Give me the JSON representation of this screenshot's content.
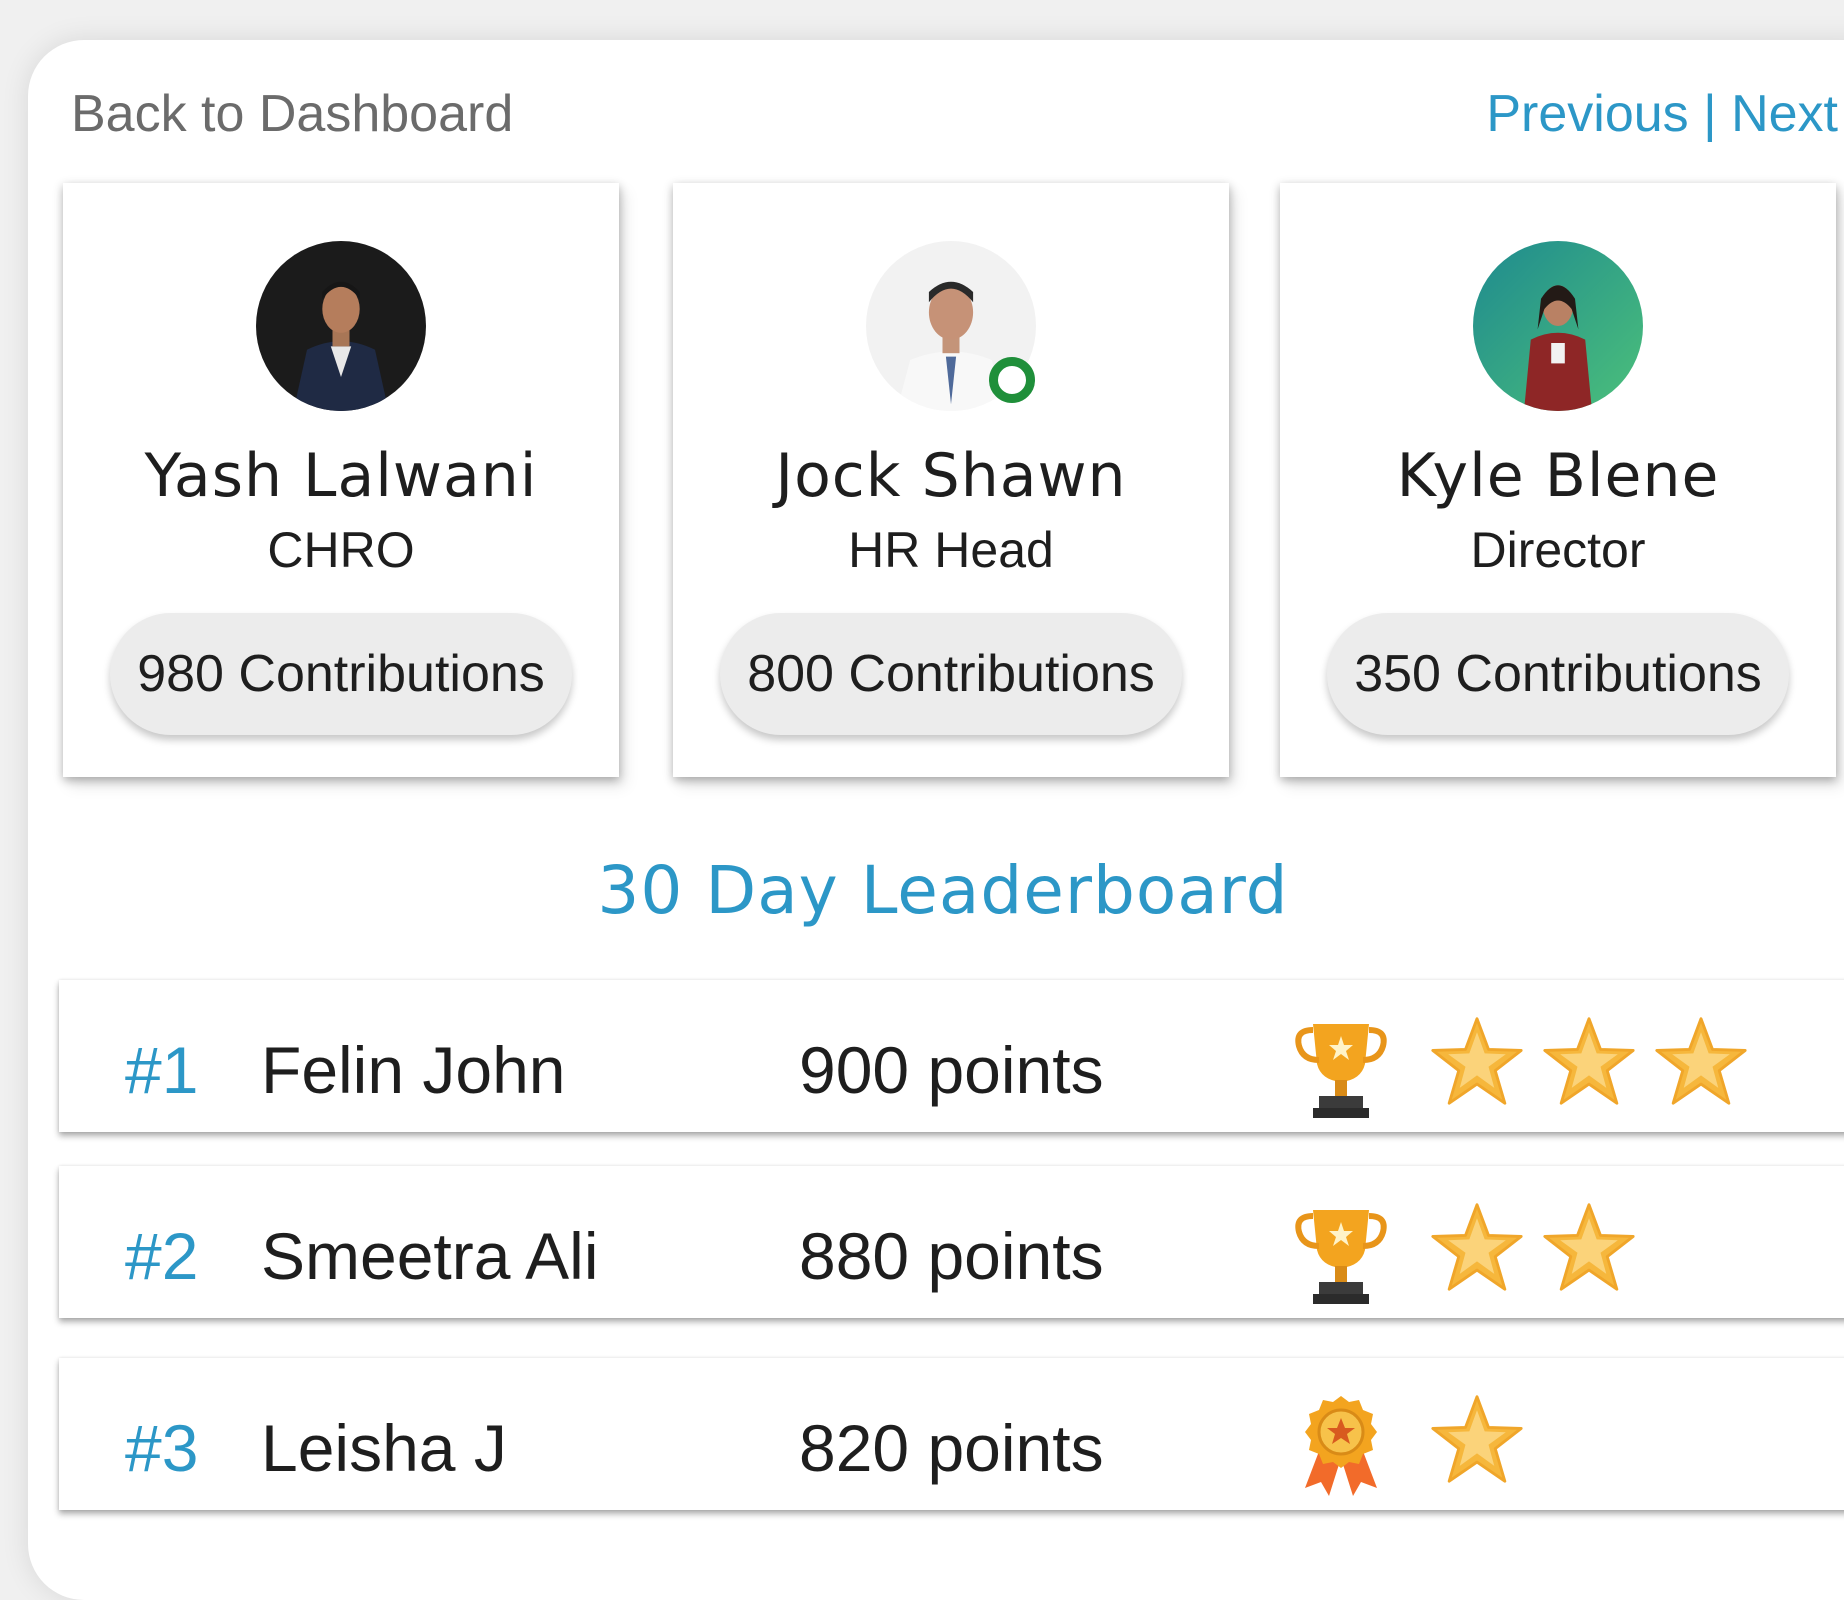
{
  "nav": {
    "back_label": "Back to Dashboard",
    "previous_label": "Previous",
    "separator": "|",
    "next_label": "Next"
  },
  "featured": [
    {
      "name": "Yash Lalwani",
      "role": "CHRO",
      "contributions": "980 Contributions",
      "online": false
    },
    {
      "name": "Jock Shawn",
      "role": "HR Head",
      "contributions": "800 Contributions",
      "online": true
    },
    {
      "name": "Kyle Blene",
      "role": "Director",
      "contributions": "350 Contributions",
      "online": false
    }
  ],
  "leaderboard": {
    "title": "30 Day Leaderboard",
    "rows": [
      {
        "rank": "#1",
        "name": "Felin John",
        "points": "900 points",
        "award_icon": "trophy-icon",
        "stars": 3
      },
      {
        "rank": "#2",
        "name": "Smeetra Ali",
        "points": "880 points",
        "award_icon": "trophy-icon",
        "stars": 2
      },
      {
        "rank": "#3",
        "name": "Leisha J",
        "points": "820 points",
        "award_icon": "medal-icon",
        "stars": 1
      }
    ]
  },
  "colors": {
    "accent": "#2c97c7",
    "online": "#1f8f3a",
    "star": "#f6b73c",
    "trophy": "#f3a41f",
    "ribbon": "#f26b2a"
  }
}
